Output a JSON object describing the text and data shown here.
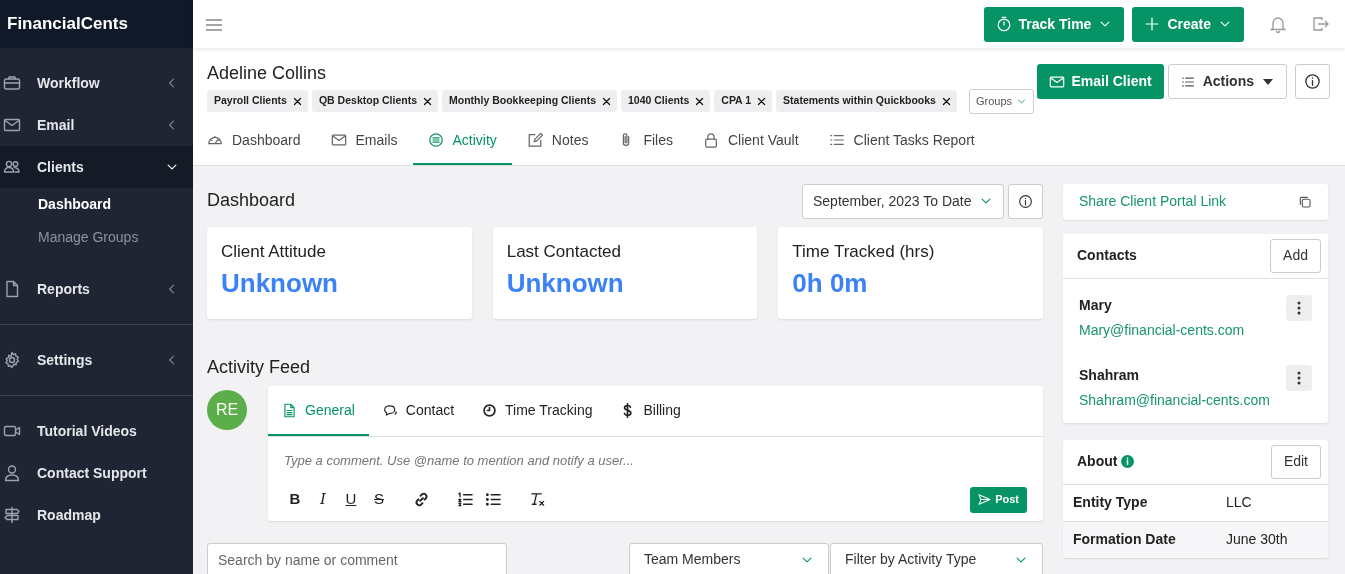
{
  "brand": "FinancialCents",
  "nav_sections": [
    [
      {
        "label": "Workflow",
        "kind": "menu",
        "expanded": false
      },
      {
        "label": "Email",
        "kind": "menu",
        "expanded": false
      },
      {
        "label": "Clients",
        "kind": "menu",
        "expanded": true,
        "children": [
          {
            "label": "Dashboard",
            "selected": true
          },
          {
            "label": "Manage Groups",
            "selected": false
          }
        ]
      },
      {
        "label": "Reports",
        "kind": "menu",
        "expanded": false
      }
    ],
    [
      {
        "label": "Settings",
        "kind": "menu",
        "expanded": false
      }
    ],
    [
      {
        "label": "Tutorial Videos",
        "kind": "link"
      },
      {
        "label": "Contact Support",
        "kind": "link"
      },
      {
        "label": "Roadmap",
        "kind": "link"
      }
    ]
  ],
  "top_buttons": [
    {
      "label": "Track Time"
    },
    {
      "label": "Create"
    }
  ],
  "client": {
    "name": "Adeline Collins",
    "tags": [
      "Payroll Clients",
      "QB Desktop Clients",
      "Monthly Bookkeeping Clients",
      "1040 Clients",
      "CPA 1",
      "Statements within Quickbooks"
    ],
    "groups_button": "Groups",
    "email_button": "Email Client",
    "actions_button": "Actions",
    "tabs": [
      {
        "label": "Dashboard",
        "selected": false
      },
      {
        "label": "Emails",
        "selected": false
      },
      {
        "label": "Activity",
        "selected": true
      },
      {
        "label": "Notes",
        "selected": false
      },
      {
        "label": "Files",
        "selected": false
      },
      {
        "label": "Client Vault",
        "selected": false
      },
      {
        "label": "Client Tasks Report",
        "selected": false
      }
    ]
  },
  "dashboard": {
    "title": "Dashboard",
    "date_range": "September, 2023 To Date",
    "stats": [
      {
        "label": "Client Attitude",
        "value": "Unknown"
      },
      {
        "label": "Last Contacted",
        "value": "Unknown"
      },
      {
        "label": "Time Tracked (hrs)",
        "value": "0h 0m"
      }
    ]
  },
  "activity_feed": {
    "title": "Activity Feed",
    "avatar": "RE",
    "tabs": [
      {
        "label": "General",
        "selected": true
      },
      {
        "label": "Contact",
        "selected": false
      },
      {
        "label": "Time Tracking",
        "selected": false
      },
      {
        "label": "Billing",
        "selected": false
      }
    ],
    "placeholder": "Type a comment. Use @name to mention and notify a user...",
    "tools": [
      {
        "kind": "bold",
        "label": "B"
      },
      {
        "kind": "italic",
        "label": "I"
      },
      {
        "kind": "underline",
        "label": "U"
      },
      {
        "kind": "strike",
        "label": "S"
      },
      {
        "kind": "link"
      },
      {
        "kind": "ordered-list"
      },
      {
        "kind": "bullet-list"
      },
      {
        "kind": "clear-format"
      }
    ],
    "post_button": "Post",
    "search_placeholder": "Search by name or comment",
    "filters": [
      "Team Members",
      "Filter by Activity Type"
    ]
  },
  "share_link": "Share Client Portal Link",
  "contacts": {
    "title": "Contacts",
    "add_button": "Add",
    "items": [
      {
        "name": "Mary",
        "email": "Mary@financial-cents.com"
      },
      {
        "name": "Shahram",
        "email": "Shahram@financial-cents.com"
      }
    ]
  },
  "about": {
    "title": "About",
    "edit_button": "Edit",
    "rows": [
      {
        "label": "Entity Type",
        "value": "LLC"
      },
      {
        "label": "Formation Date",
        "value": "June 30th"
      }
    ]
  }
}
